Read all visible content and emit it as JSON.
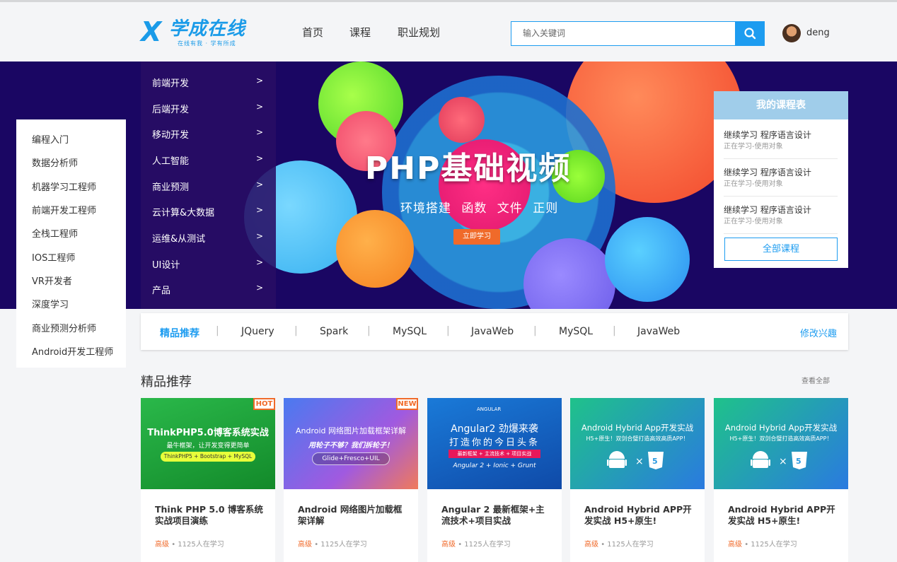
{
  "header": {
    "logo_mark": "X",
    "logo_text": "学成在线",
    "logo_slogan": "在线有我 · 学有所成",
    "nav": [
      "首页",
      "课程",
      "职业规划"
    ],
    "search_placeholder": "输入关键词",
    "username": "deng"
  },
  "banner": {
    "title": "PHP基础视频",
    "subtitle": "环境搭建 函数 文件 正则",
    "button": "立即学习"
  },
  "category_menu": [
    {
      "label": "前端开发",
      "arrow": ">"
    },
    {
      "label": "后端开发",
      "arrow": ">"
    },
    {
      "label": "移动开发",
      "arrow": ">"
    },
    {
      "label": "人工智能",
      "arrow": ">"
    },
    {
      "label": "商业预测",
      "arrow": ">"
    },
    {
      "label": "云计算&大数据",
      "arrow": ">"
    },
    {
      "label": "运维&从测试",
      "arrow": ">"
    },
    {
      "label": "UI设计",
      "arrow": ">"
    },
    {
      "label": "产品",
      "arrow": ">"
    }
  ],
  "careers": [
    "编程入门",
    "数据分析师",
    "机器学习工程师",
    "前端开发工程师",
    "全栈工程师",
    "IOS工程师",
    "VR开发者",
    "深度学习",
    "商业预测分析师",
    "Android开发工程师"
  ],
  "schedule": {
    "title": "我的课程表",
    "items": [
      {
        "title": "继续学习 程序语言设计",
        "sub": "正在学习-使用对象"
      },
      {
        "title": "继续学习 程序语言设计",
        "sub": "正在学习-使用对象"
      },
      {
        "title": "继续学习 程序语言设计",
        "sub": "正在学习-使用对象"
      }
    ],
    "all_button": "全部课程"
  },
  "interests": {
    "tags": [
      "精品推荐",
      "JQuery",
      "Spark",
      "MySQL",
      "JavaWeb",
      "MySQL",
      "JavaWeb"
    ],
    "separator": "|",
    "modify": "修改兴趣"
  },
  "section": {
    "title": "精品推荐",
    "view_all": "查看全部"
  },
  "courses": [
    {
      "badge": "HOT",
      "img_title": "ThinkPHP5.0博客系统实战",
      "img_sub": "最牛框架，让开发变得更简单",
      "img_tag": "ThinkPHP5 + Bootstrap + MySQL",
      "title": "Think PHP 5.0 博客系统实战项目演练",
      "level": "高级",
      "learners": "• 1125人在学习"
    },
    {
      "badge": "NEW",
      "img_title": "Android 网络图片加载框架详解",
      "img_sub": "用轮子不够？我们拆轮子！",
      "img_tag": "Glide+Fresco+UIL",
      "title": "Android 网络图片加载框架详解",
      "level": "高级",
      "learners": "• 1125人在学习"
    },
    {
      "badge": "",
      "img_title": "Angular2 劲爆来袭",
      "img_sub": "打造你的今日头条",
      "img_tag": "最新框架 + 主流技术 + 项目实战",
      "img_brand": "ANGULAR",
      "img_foot": "Angular 2 + Ionic + Grunt",
      "title": "Angular 2 最新框架+主流技术+项目实战",
      "level": "高级",
      "learners": "• 1125人在学习"
    },
    {
      "badge": "",
      "img_title": "Android Hybrid App开发实战",
      "img_sub": "H5+原生！双剑合璧打造高效高质APP！",
      "img_tag": "",
      "title": "Android Hybrid APP开发实战 H5+原生!",
      "level": "高级",
      "learners": "• 1125人在学习"
    },
    {
      "badge": "",
      "img_title": "Android Hybrid App开发实战",
      "img_sub": "H5+原生！双剑合璧打造高效高质APP！",
      "img_tag": "",
      "title": "Android Hybrid APP开发实战 H5+原生!",
      "level": "高级",
      "learners": "• 1125人在学习"
    }
  ],
  "colors": {
    "accent": "#1d9cf0",
    "banner_bg": "#1a0663",
    "orange": "#f06a2a"
  }
}
